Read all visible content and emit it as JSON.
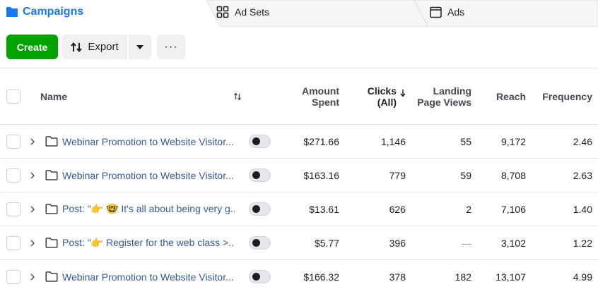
{
  "tabs": [
    {
      "label": "Campaigns",
      "icon": "folder-icon",
      "active": true
    },
    {
      "label": "Ad Sets",
      "icon": "grid-icon",
      "active": false
    },
    {
      "label": "Ads",
      "icon": "ad-frame-icon",
      "active": false
    }
  ],
  "toolbar": {
    "create_label": "Create",
    "export_label": "Export",
    "more_label": "···"
  },
  "columns": {
    "name": "Name",
    "amount_spent_1": "Amount",
    "amount_spent_2": "Spent",
    "clicks_1": "Clicks",
    "clicks_2": "(All)",
    "lpv_1": "Landing",
    "lpv_2": "Page Views",
    "reach": "Reach",
    "frequency": "Frequency"
  },
  "rows": [
    {
      "name": "Webinar Promotion to Website Visitor...",
      "spent": "$271.66",
      "clicks": "1,146",
      "lpv": "55",
      "reach": "9,172",
      "frequency": "2.46"
    },
    {
      "name": "Webinar Promotion to Website Visitor...",
      "spent": "$163.16",
      "clicks": "779",
      "lpv": "59",
      "reach": "8,708",
      "frequency": "2.63"
    },
    {
      "name": "Post: \"👉 🤓 It's all about being very g...",
      "spent": "$13.61",
      "clicks": "626",
      "lpv": "2",
      "reach": "7,106",
      "frequency": "1.40"
    },
    {
      "name": "Post: \"👉 Register for the web class >...",
      "spent": "$5.77",
      "clicks": "396",
      "lpv": "—",
      "reach": "3,102",
      "frequency": "1.22"
    },
    {
      "name": "Webinar Promotion to Website Visitor...",
      "spent": "$166.32",
      "clicks": "378",
      "lpv": "182",
      "reach": "13,107",
      "frequency": "4.99"
    }
  ],
  "colors": {
    "brand_blue": "#1877f2",
    "link_blue": "#385898",
    "create_green": "#00a400"
  }
}
